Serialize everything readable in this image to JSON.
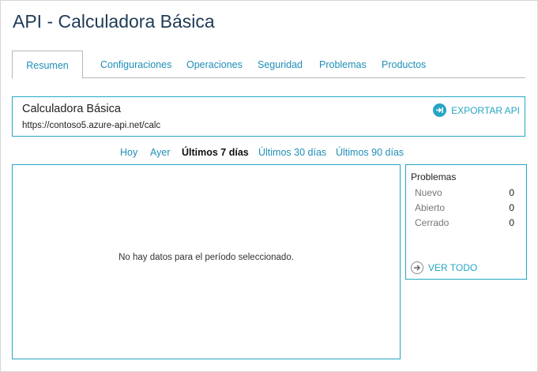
{
  "page": {
    "title": "API - Calculadora Básica"
  },
  "tabs": [
    {
      "label": "Resumen",
      "active": true
    },
    {
      "label": "Configuraciones"
    },
    {
      "label": "Operaciones"
    },
    {
      "label": "Seguridad"
    },
    {
      "label": "Problemas"
    },
    {
      "label": "Productos"
    }
  ],
  "api": {
    "name": "Calculadora Básica",
    "url": "https://contoso5.azure-api.net/calc",
    "export_label": "EXPORTAR API",
    "export_icon": "export-arrow-icon"
  },
  "periods": [
    {
      "label": "Hoy"
    },
    {
      "label": "Ayer"
    },
    {
      "label": "Últimos 7 días",
      "active": true
    },
    {
      "label": "Últimos 30 días"
    },
    {
      "label": "Últimos 90 días"
    }
  ],
  "chart": {
    "empty_message": "No hay datos para el período seleccionado."
  },
  "issues": {
    "title": "Problemas",
    "rows": [
      {
        "label": "Nuevo",
        "count": "0"
      },
      {
        "label": "Abierto",
        "count": "0"
      },
      {
        "label": "Cerrado",
        "count": "0"
      }
    ],
    "view_all_label": "VER TODO",
    "view_all_icon": "arrow-right-circle-icon"
  },
  "colors": {
    "accent": "#27a5c4",
    "link": "#1f8fb7",
    "title": "#1f3a56"
  }
}
